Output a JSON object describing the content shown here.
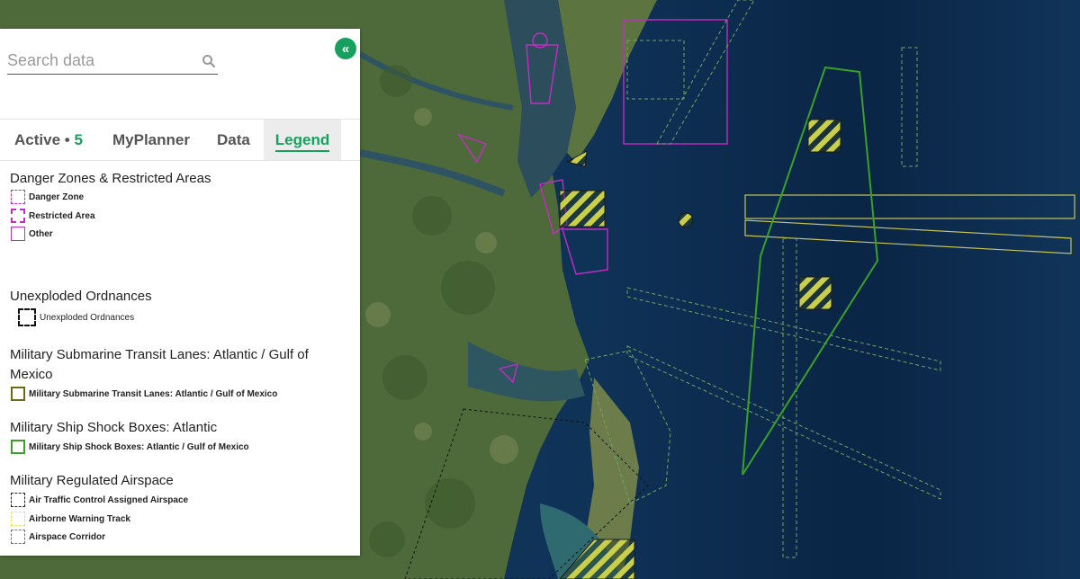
{
  "search": {
    "placeholder": "Search data"
  },
  "collapse": {
    "icon": "«"
  },
  "tabs": [
    {
      "label": "Active •",
      "count": "5"
    },
    {
      "label": "MyPlanner"
    },
    {
      "label": "Data"
    },
    {
      "label": "Legend"
    }
  ],
  "active_tab": "Legend",
  "legend": {
    "danger": {
      "title": "Danger Zones & Restricted Areas",
      "items": [
        "Danger Zone",
        "Restricted Area",
        "Other"
      ]
    },
    "uxo": {
      "title": "Unexploded Ordnances",
      "items": [
        "Unexploded Ordnances"
      ]
    },
    "subs": {
      "title": "Military Submarine Transit Lanes: Atlantic / Gulf of Mexico",
      "items": [
        "Military Submarine Transit Lanes: Atlantic / Gulf of Mexico"
      ]
    },
    "shock": {
      "title": "Military Ship Shock Boxes: Atlantic",
      "items": [
        "Military Ship Shock Boxes: Atlantic / Gulf of Mexico"
      ]
    },
    "airspace": {
      "title": "Military Regulated Airspace",
      "items": [
        "Air Traffic Control Assigned Airspace",
        "Airborne Warning Track",
        "Airspace Corridor"
      ]
    }
  },
  "colors": {
    "accent": "#17a05d",
    "danger_zone": "#c42cc4",
    "restricted": "#c42cc4",
    "other": "#c42cc4",
    "uxo": "#111111",
    "sub_lanes": "#6b6b17",
    "shock_box": "#3aa02a",
    "atcaa": "#222222",
    "warning_track": "#e8e46a",
    "corridor": "#777777"
  }
}
